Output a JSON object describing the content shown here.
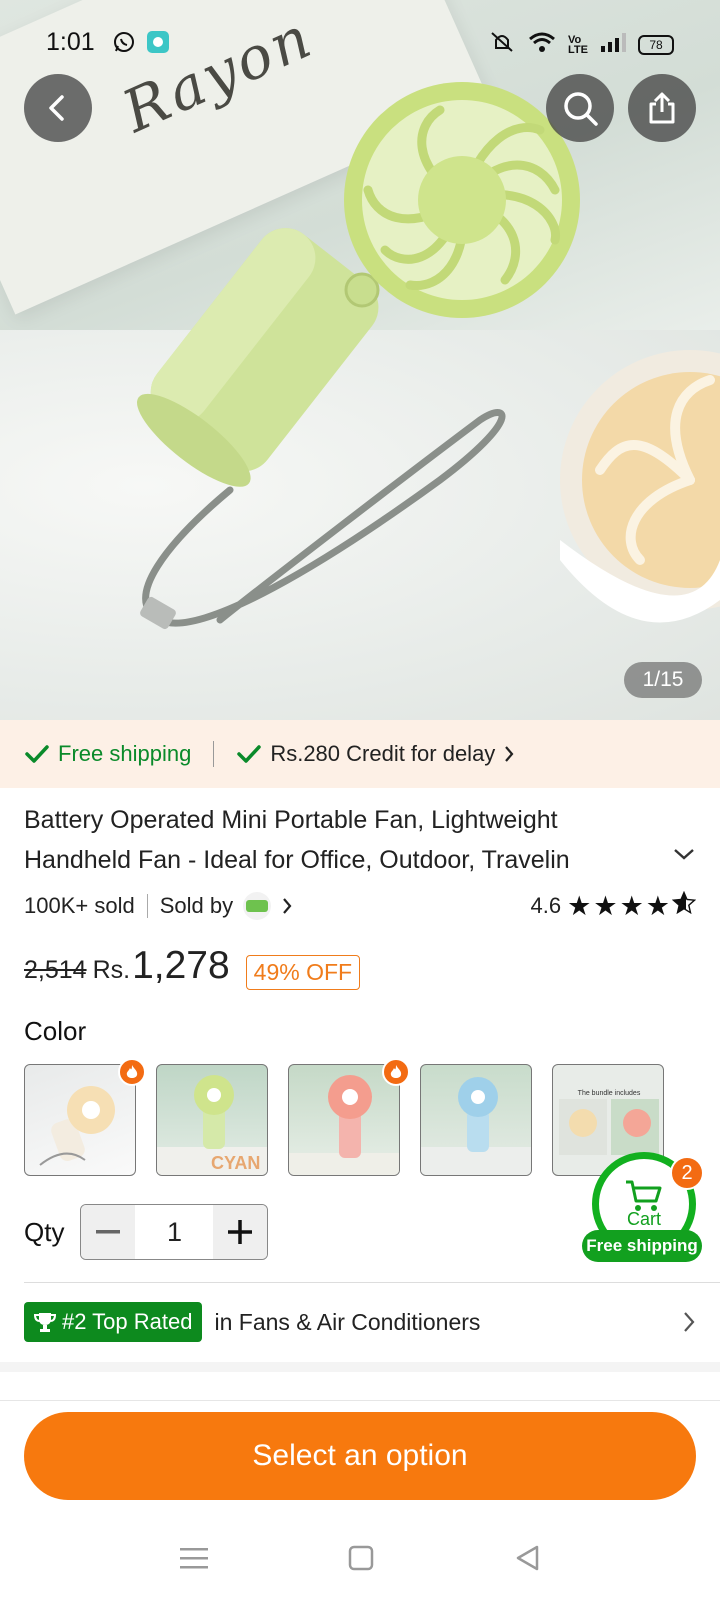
{
  "status_bar": {
    "time": "1:01",
    "battery": "78"
  },
  "hero": {
    "card_text": "Rayon",
    "image_counter": "1/15"
  },
  "shipping_strip": {
    "free_shipping": "Free shipping",
    "credit": "Rs.280 Credit for delay"
  },
  "product": {
    "title_line1": "Battery Operated Mini Portable Fan, Lightweight",
    "title_line2": "Handheld Fan - Ideal for Office, Outdoor, Travelin",
    "sold": "100K+ sold",
    "sold_by": "Sold by",
    "rating": "4.6",
    "rating_value": 4.6,
    "old_price": "2,514",
    "currency": "Rs.",
    "price": "1,278",
    "discount": "49% OFF"
  },
  "color": {
    "label": "Color",
    "swatches": [
      {
        "name": "beige",
        "hot": true
      },
      {
        "name": "green",
        "hot": false,
        "label": "CYAN"
      },
      {
        "name": "pink",
        "hot": true
      },
      {
        "name": "blue",
        "hot": false
      },
      {
        "name": "bundle",
        "hot": false,
        "label": "The bundle includes"
      }
    ]
  },
  "quantity": {
    "label": "Qty",
    "value": "1"
  },
  "cart": {
    "label": "Cart",
    "count": "2",
    "free_shipping": "Free shipping"
  },
  "top_rated": {
    "badge": "#2 Top Rated",
    "category": "in Fans & Air Conditioners"
  },
  "cta": {
    "label": "Select an option"
  },
  "colors": {
    "accent": "#f7790e",
    "green": "#12a01f",
    "strip_bg": "#fdf0e6"
  }
}
